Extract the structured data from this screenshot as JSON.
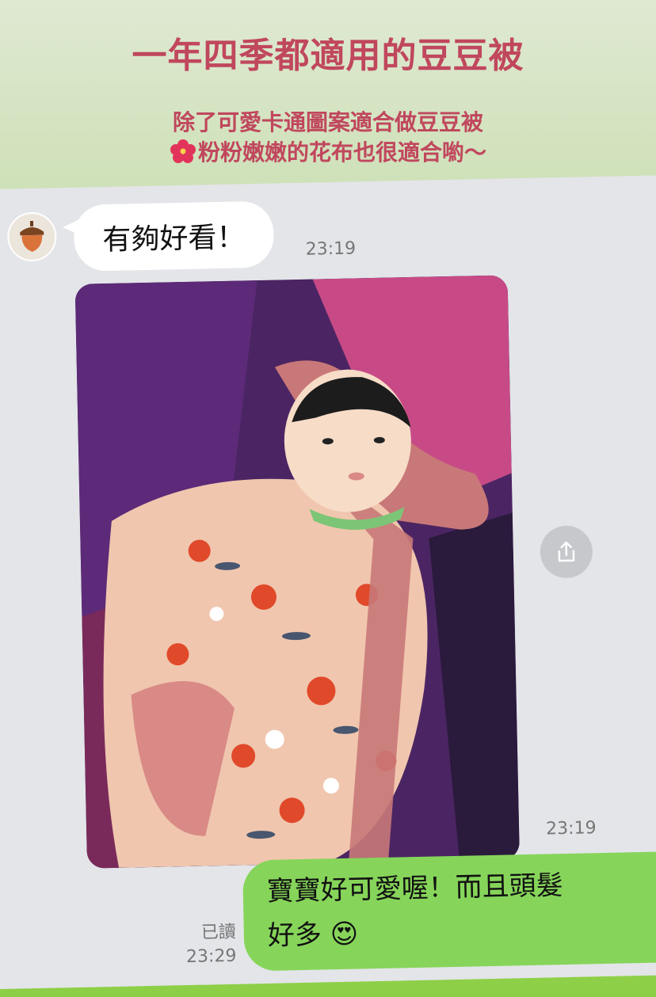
{
  "header": {
    "title": "一年四季都適用的豆豆被",
    "subtitle_line1": "除了可愛卡通圖案適合做豆豆被",
    "subtitle_line2": "粉粉嫩嫩的花布也很適合喲～"
  },
  "chat": {
    "incoming": {
      "avatar_icon": "acorn-icon",
      "text": "有夠好看！",
      "time": "23:19"
    },
    "photo": {
      "time": "23:19",
      "share_icon": "share-icon"
    },
    "outgoing": {
      "line1": "寶寶好可愛喔！而且頭髮",
      "line2": "好多",
      "emoji": "😍",
      "read_label": "已讀",
      "time": "23:29"
    }
  },
  "colors": {
    "title": "#c0475d",
    "outgoing_bubble": "#86d55a",
    "incoming_bubble": "#ffffff",
    "chat_bg": "#e3e5e8"
  }
}
